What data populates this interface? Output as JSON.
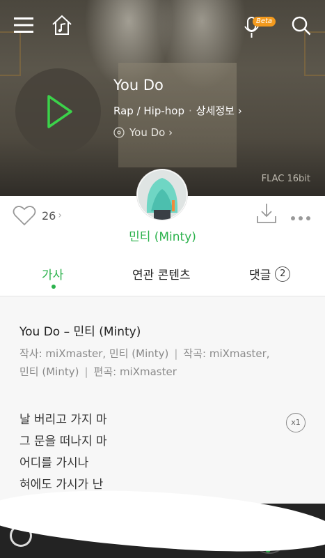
{
  "header": {
    "menu_icon": "hamburger-menu-icon",
    "home_icon": "home-music-icon",
    "mic_icon": "microphone-icon",
    "beta_label": "Beta",
    "search_icon": "search-icon"
  },
  "song": {
    "title": "You Do",
    "genre": "Rap / Hip-hop",
    "detail_link": "상세정보 ›",
    "album": "You Do ›",
    "quality": "FLAC 16bit"
  },
  "artist": {
    "name": "민티 (Minty)"
  },
  "actions": {
    "like_count": "26",
    "like_chevron": "›"
  },
  "tabs": {
    "lyrics": "가사",
    "related": "연관 콘텐츠",
    "comments": "댓글",
    "comments_count": "2"
  },
  "lyrics": {
    "heading": "You Do – 민티 (Minty)",
    "credit_lyricist": "작사: miXmaster, 민티 (Minty)",
    "credit_composer_a": "작곡: miXmaster,",
    "credit_composer_b": "민티 (Minty)",
    "credit_arranger": "편곡: miXmaster",
    "speed_label": "x1",
    "lines": [
      "날 버리고 가지 마",
      "그 문을 떠나지 마",
      "어디를 가시나",
      "혀에도 가시가 난"
    ]
  },
  "colors": {
    "accent": "#2bb24c",
    "beta": "#f39a1e"
  }
}
